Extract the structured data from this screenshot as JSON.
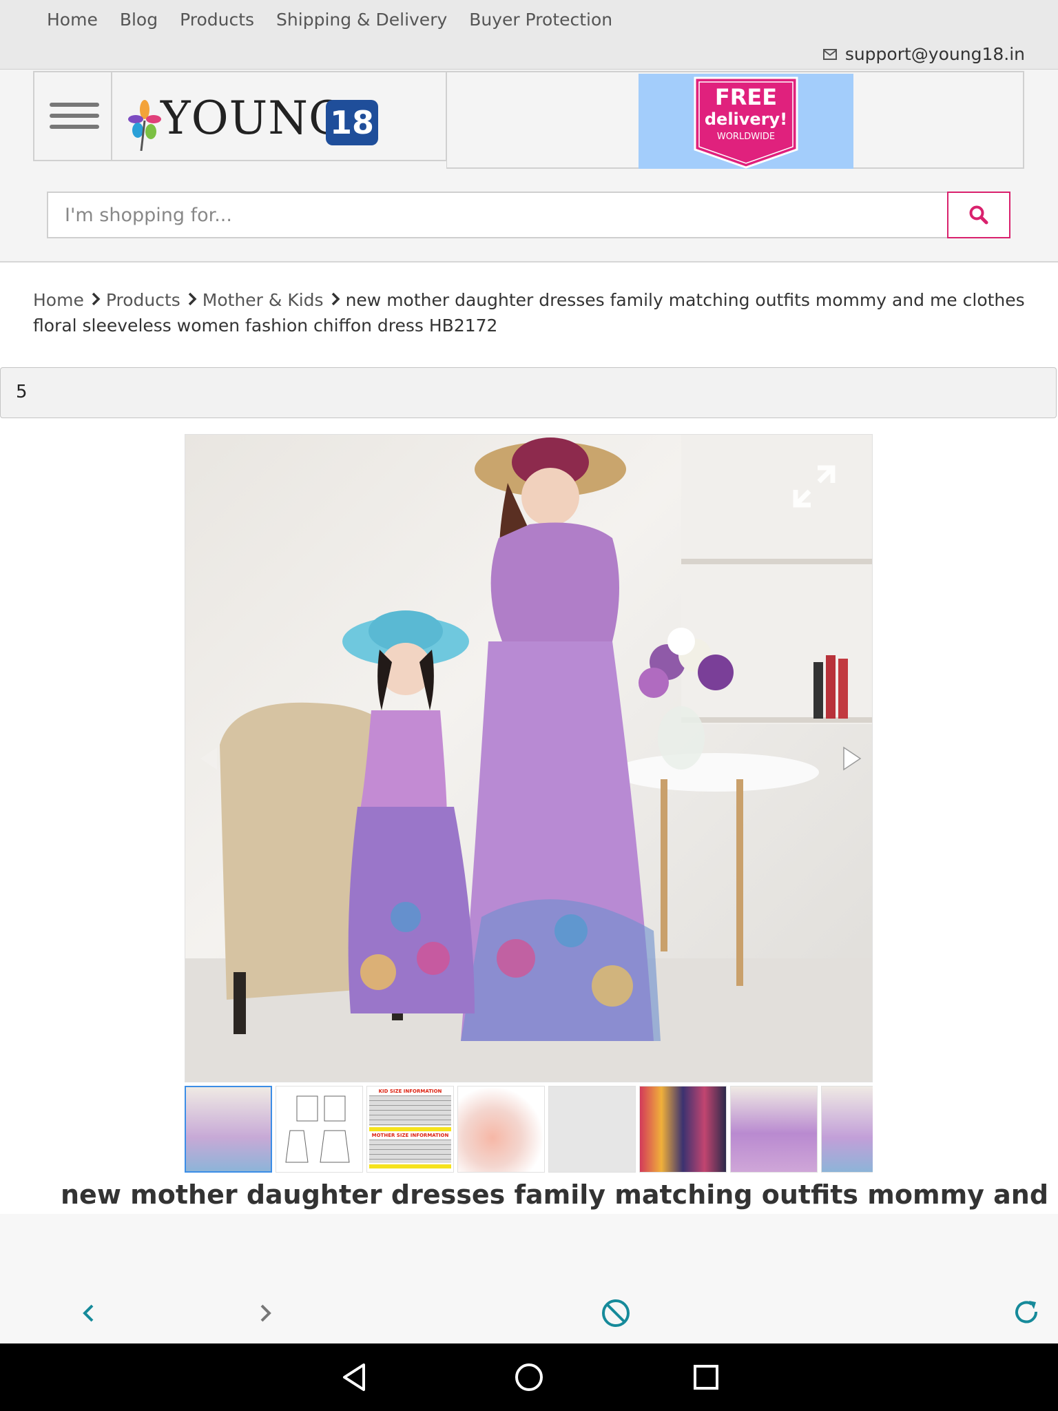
{
  "topnav": {
    "links": [
      "Home",
      "Blog",
      "Products",
      "Shipping & Delivery",
      "Buyer Protection"
    ],
    "support_email": "support@young18.in"
  },
  "header": {
    "logo_text": "YOUNG",
    "logo_badge": "18",
    "banner": {
      "line1": "FREE",
      "line2": "delivery!",
      "line3": "WORLDWIDE"
    }
  },
  "search": {
    "placeholder": "I'm shopping for..."
  },
  "breadcrumb": {
    "items": [
      "Home",
      "Products",
      "Mother & Kids"
    ],
    "current": "new mother daughter dresses family matching outfits mommy and me clothes floral sleeveless women fashion chiffon dress HB2172"
  },
  "quantity_bar": {
    "value": "5"
  },
  "gallery": {
    "thumb_count": 8,
    "thumbs": [
      {
        "icon": "product-photo",
        "caption": ""
      },
      {
        "icon": "size-sketch",
        "caption": ""
      },
      {
        "icon": "size-chart",
        "caption": "KID SIZE INFORMATION",
        "caption2": "MOTHER SIZE INFORMATION"
      },
      {
        "icon": "product-photo",
        "caption": ""
      },
      {
        "icon": "blank",
        "caption": ""
      },
      {
        "icon": "product-photo",
        "caption": ""
      },
      {
        "icon": "product-photo",
        "caption": ""
      },
      {
        "icon": "product-photo",
        "caption": ""
      }
    ]
  },
  "product": {
    "title": "new mother daughter dresses family matching outfits mommy and"
  },
  "colors": {
    "accent": "#d9216d",
    "nav_bg": "#e9e9e9",
    "teal": "#168a9a"
  }
}
